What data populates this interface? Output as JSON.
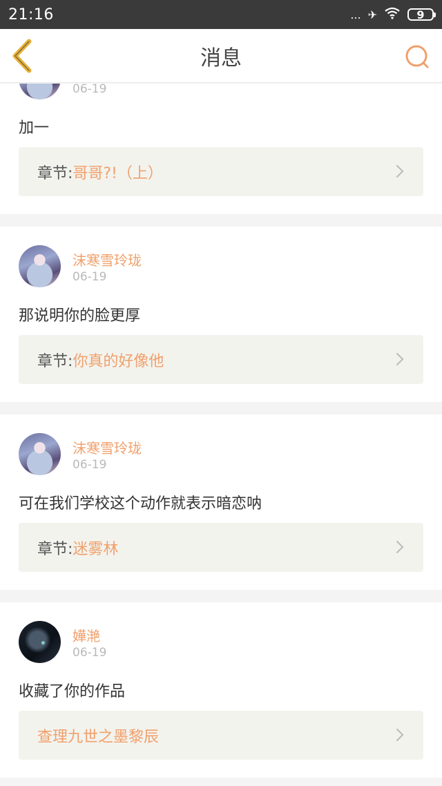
{
  "status_bar": {
    "time": "21:16",
    "signal": "...",
    "battery": "9"
  },
  "header": {
    "title": "消息"
  },
  "messages": [
    {
      "username": "",
      "avatar_icon": "anime-girl-avatar",
      "date": "06-19",
      "comment": "加一",
      "ref_prefix": "章节:",
      "ref_title": "哥哥?!（上）"
    },
    {
      "username": "沫寒雪玲珑",
      "avatar_icon": "anime-girl-avatar",
      "date": "06-19",
      "comment": "那说明你的脸更厚",
      "ref_prefix": "章节:",
      "ref_title": "你真的好像他"
    },
    {
      "username": "沫寒雪玲珑",
      "avatar_icon": "anime-girl-avatar",
      "date": "06-19",
      "comment": "可在我们学校这个动作就表示暗恋呐",
      "ref_prefix": "章节:",
      "ref_title": "迷雾林"
    },
    {
      "username": "嬅滟",
      "avatar_icon": "dark-wolf-avatar",
      "date": "06-19",
      "comment": "收藏了你的作品",
      "ref_prefix": "",
      "ref_title": "查理九世之墨黎辰"
    }
  ],
  "colors": {
    "accent": "#f0a06b",
    "back_icon": "#e8b23b",
    "ref_bg": "#f3f3ee"
  }
}
